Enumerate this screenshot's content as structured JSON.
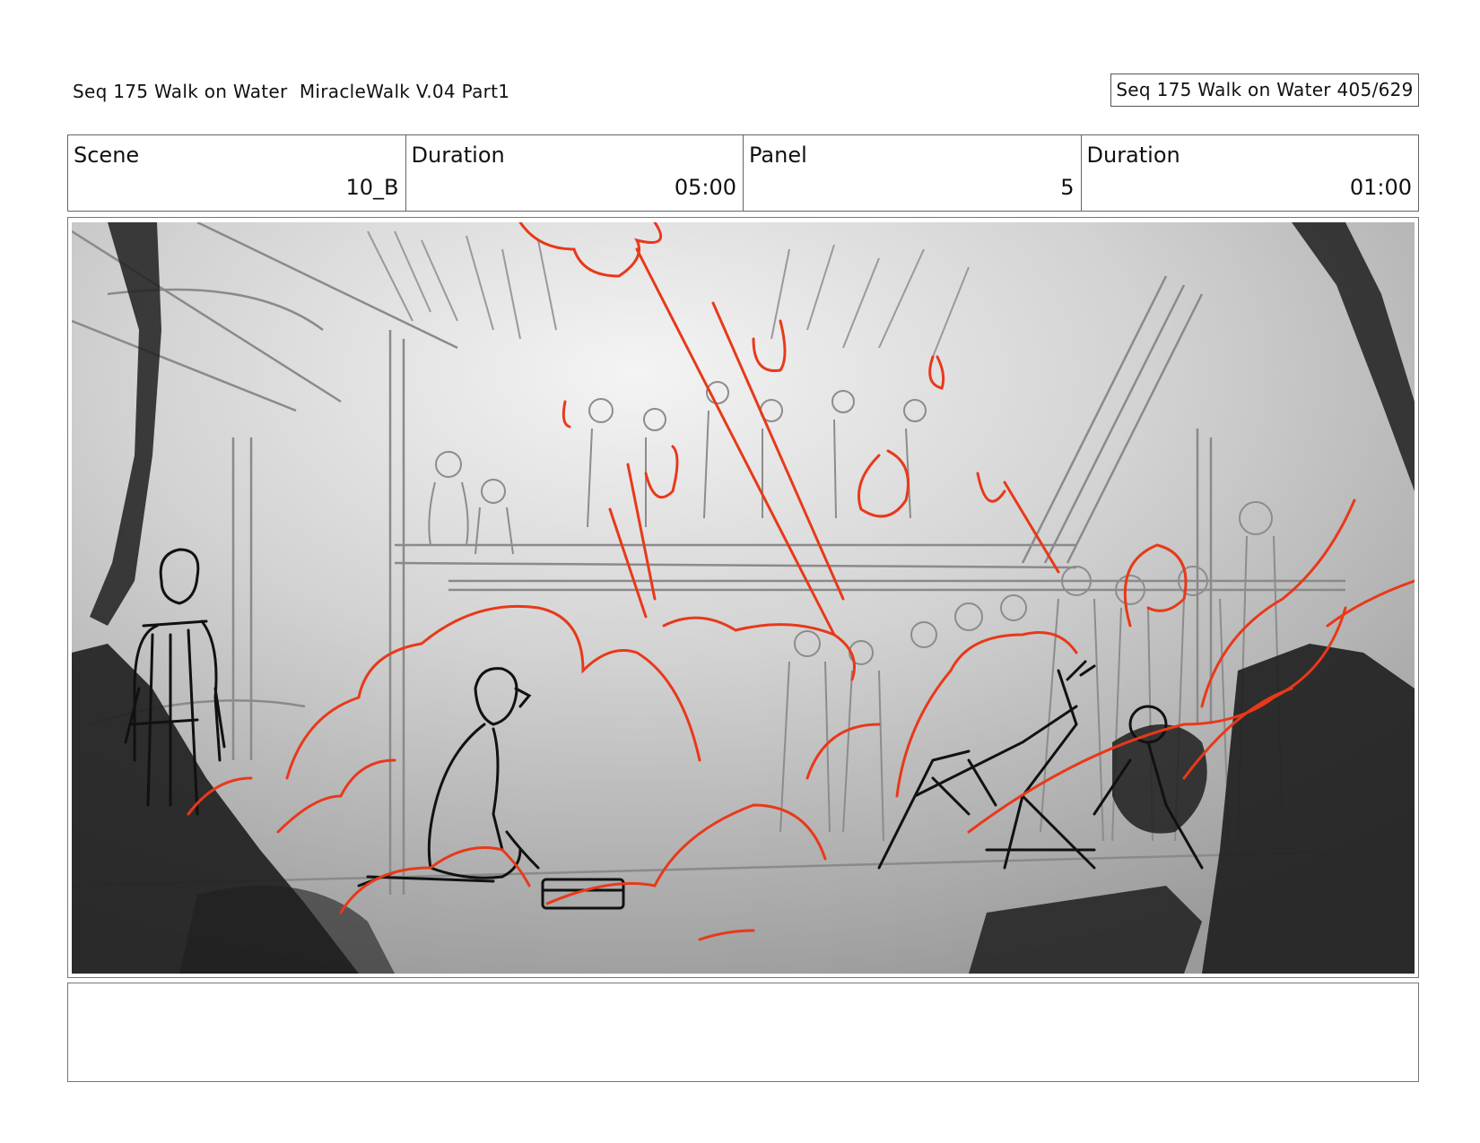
{
  "header": {
    "title": "Seq 175 Walk on Water  MiracleWalk V.04 Part1",
    "page_counter": "Seq 175 Walk on Water 405/629"
  },
  "info": {
    "scene_label": "Scene",
    "scene_value": "10_B",
    "scene_duration_label": "Duration",
    "scene_duration_value": "05:00",
    "panel_label": "Panel",
    "panel_value": "5",
    "panel_duration_label": "Duration",
    "panel_duration_value": "01:00"
  },
  "panel": {
    "sketch_color": "#222222",
    "highlight_color": "#e8391a"
  },
  "notes": {
    "text": ""
  }
}
